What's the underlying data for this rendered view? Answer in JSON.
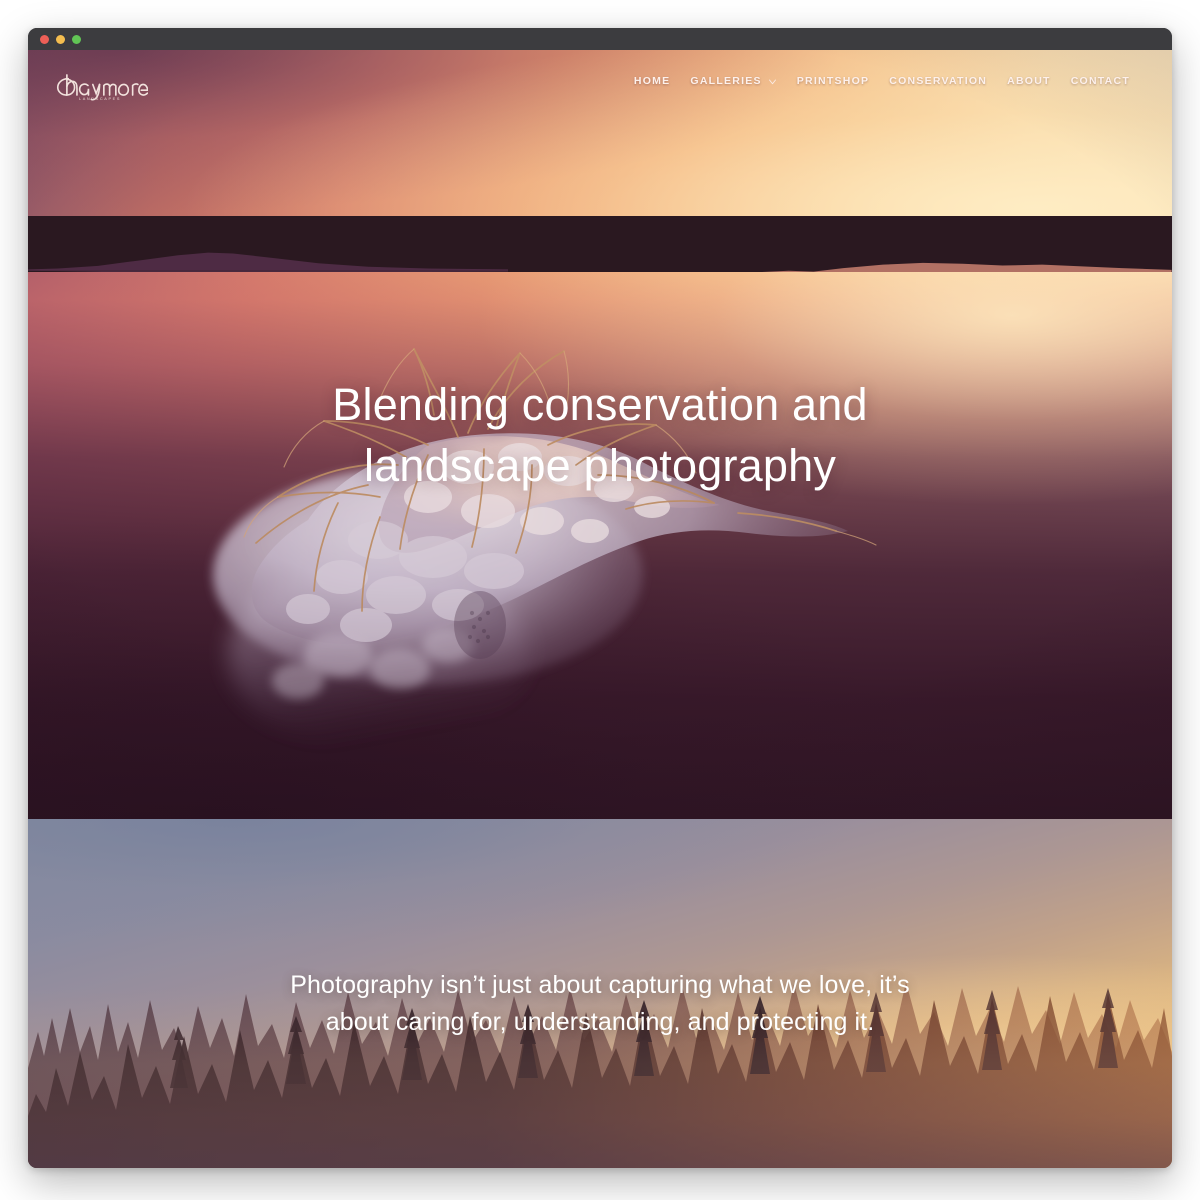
{
  "window": {
    "traffic_lights": [
      {
        "name": "close",
        "color": "#ee5f57"
      },
      {
        "name": "minimize",
        "color": "#f4bd4f"
      },
      {
        "name": "zoom",
        "color": "#61c555"
      }
    ]
  },
  "header": {
    "logo": {
      "wordmark": "haymore",
      "tagline": "LANDSCAPES",
      "icon": "logo-mark"
    },
    "nav": [
      {
        "label": "HOME",
        "has_caret": false
      },
      {
        "label": "GALLERIES",
        "has_caret": true,
        "caret_icon": "chevron-down-icon"
      },
      {
        "label": "PRINTSHOP",
        "has_caret": false
      },
      {
        "label": "CONSERVATION",
        "has_caret": false
      },
      {
        "label": "ABOUT",
        "has_caret": false
      },
      {
        "label": "CONTACT",
        "has_caret": false
      }
    ]
  },
  "hero": {
    "heading_line_1": "Blending conservation and",
    "heading_line_2": "landscape photography",
    "image_alt": "sunset-lake-ice-formation"
  },
  "forest_section": {
    "quote_line_1": "Photography isn’t just about capturing what we love, it’s",
    "quote_line_2": "about caring for, understanding, and protecting it.",
    "image_alt": "misty-pine-forest-sunrise"
  },
  "colors": {
    "page_background": "#ffffff",
    "titlebar": "#3c3c3f",
    "nav_text": "#fdf1ec",
    "heading_text": "#ffffff",
    "hero_sky_warm": "#f0ae7d",
    "hero_water_deep": "#38192a",
    "forest_sky_blue": "#8289a0",
    "forest_sky_gold": "#f0cc96"
  }
}
